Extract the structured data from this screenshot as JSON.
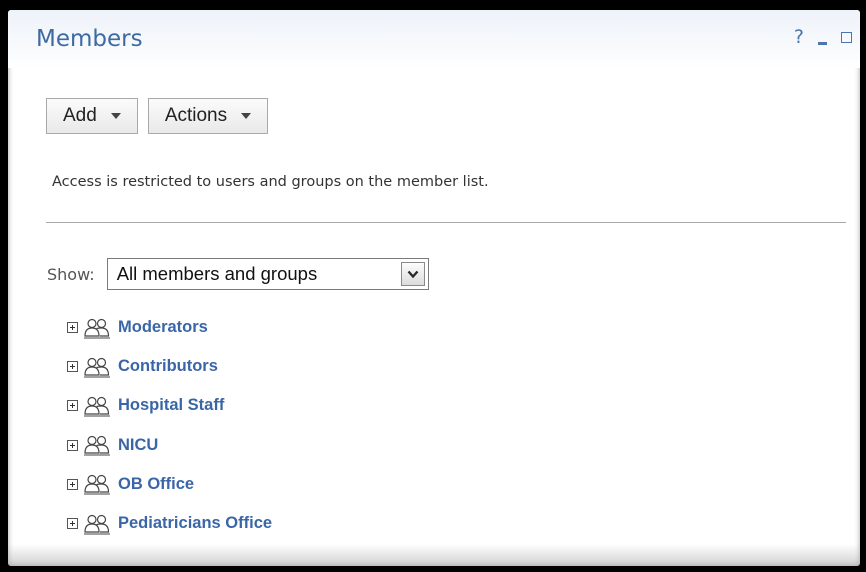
{
  "panel": {
    "title": "Members",
    "controls": {
      "help": "?",
      "minimize_icon": "minimize-icon",
      "maximize_icon": "maximize-icon"
    }
  },
  "toolbar": {
    "add_label": "Add",
    "actions_label": "Actions"
  },
  "notice": "Access is restricted to users and groups on the member list.",
  "filter": {
    "label": "Show:",
    "selected": "All members and groups"
  },
  "groups": [
    {
      "name": "Moderators"
    },
    {
      "name": "Contributors"
    },
    {
      "name": "Hospital Staff"
    },
    {
      "name": "NICU"
    },
    {
      "name": "OB Office"
    },
    {
      "name": "Pediatricians Office"
    }
  ],
  "colors": {
    "title": "#3d6aa3",
    "link": "#3a66a8",
    "background": "#000000"
  }
}
